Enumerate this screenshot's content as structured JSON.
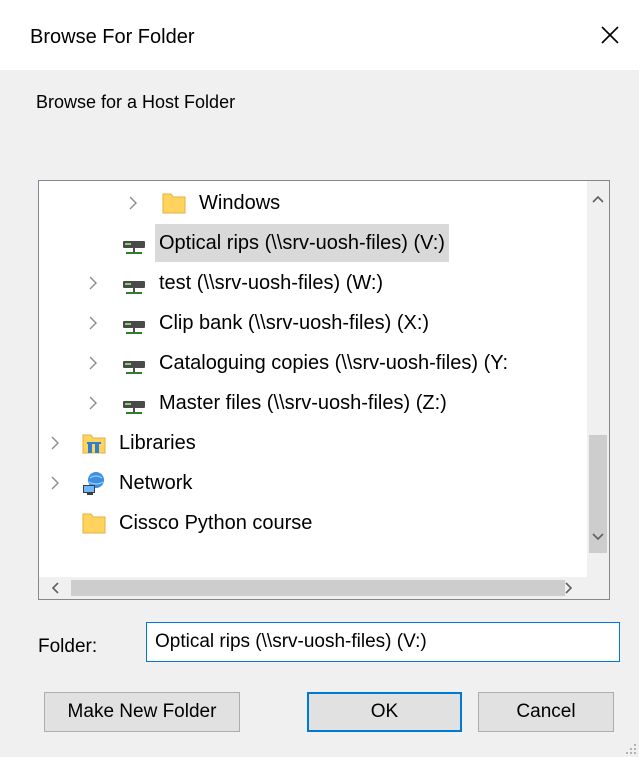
{
  "window": {
    "title": "Browse For Folder",
    "description": "Browse for a Host Folder"
  },
  "tree": {
    "items": [
      {
        "label": "Windows",
        "icon": "folder-icon",
        "expandable": true,
        "selected": false
      },
      {
        "label": "Optical rips (\\\\srv-uosh-files) (V:)",
        "icon": "network-drive-icon",
        "expandable": false,
        "selected": true
      },
      {
        "label": "test (\\\\srv-uosh-files) (W:)",
        "icon": "network-drive-icon",
        "expandable": true,
        "selected": false
      },
      {
        "label": "Clip bank (\\\\srv-uosh-files) (X:)",
        "icon": "network-drive-icon",
        "expandable": true,
        "selected": false
      },
      {
        "label": "Cataloguing copies (\\\\srv-uosh-files) (Y:",
        "icon": "network-drive-icon",
        "expandable": true,
        "selected": false
      },
      {
        "label": "Master files (\\\\srv-uosh-files) (Z:)",
        "icon": "network-drive-icon",
        "expandable": true,
        "selected": false
      },
      {
        "label": "Libraries",
        "icon": "libraries-icon",
        "expandable": true,
        "selected": false
      },
      {
        "label": "Network",
        "icon": "network-icon",
        "expandable": true,
        "selected": false
      },
      {
        "label": "Cissco Python course",
        "icon": "folder-icon",
        "expandable": false,
        "selected": false
      }
    ]
  },
  "folder_field": {
    "label": "Folder:",
    "value": "Optical rips (\\\\srv-uosh-files) (V:)"
  },
  "buttons": {
    "make_new_folder": "Make New Folder",
    "ok": "OK",
    "cancel": "Cancel"
  },
  "colors": {
    "accent": "#0078d7",
    "selection": "#d9d9d9",
    "folder": "#ffd35c"
  }
}
